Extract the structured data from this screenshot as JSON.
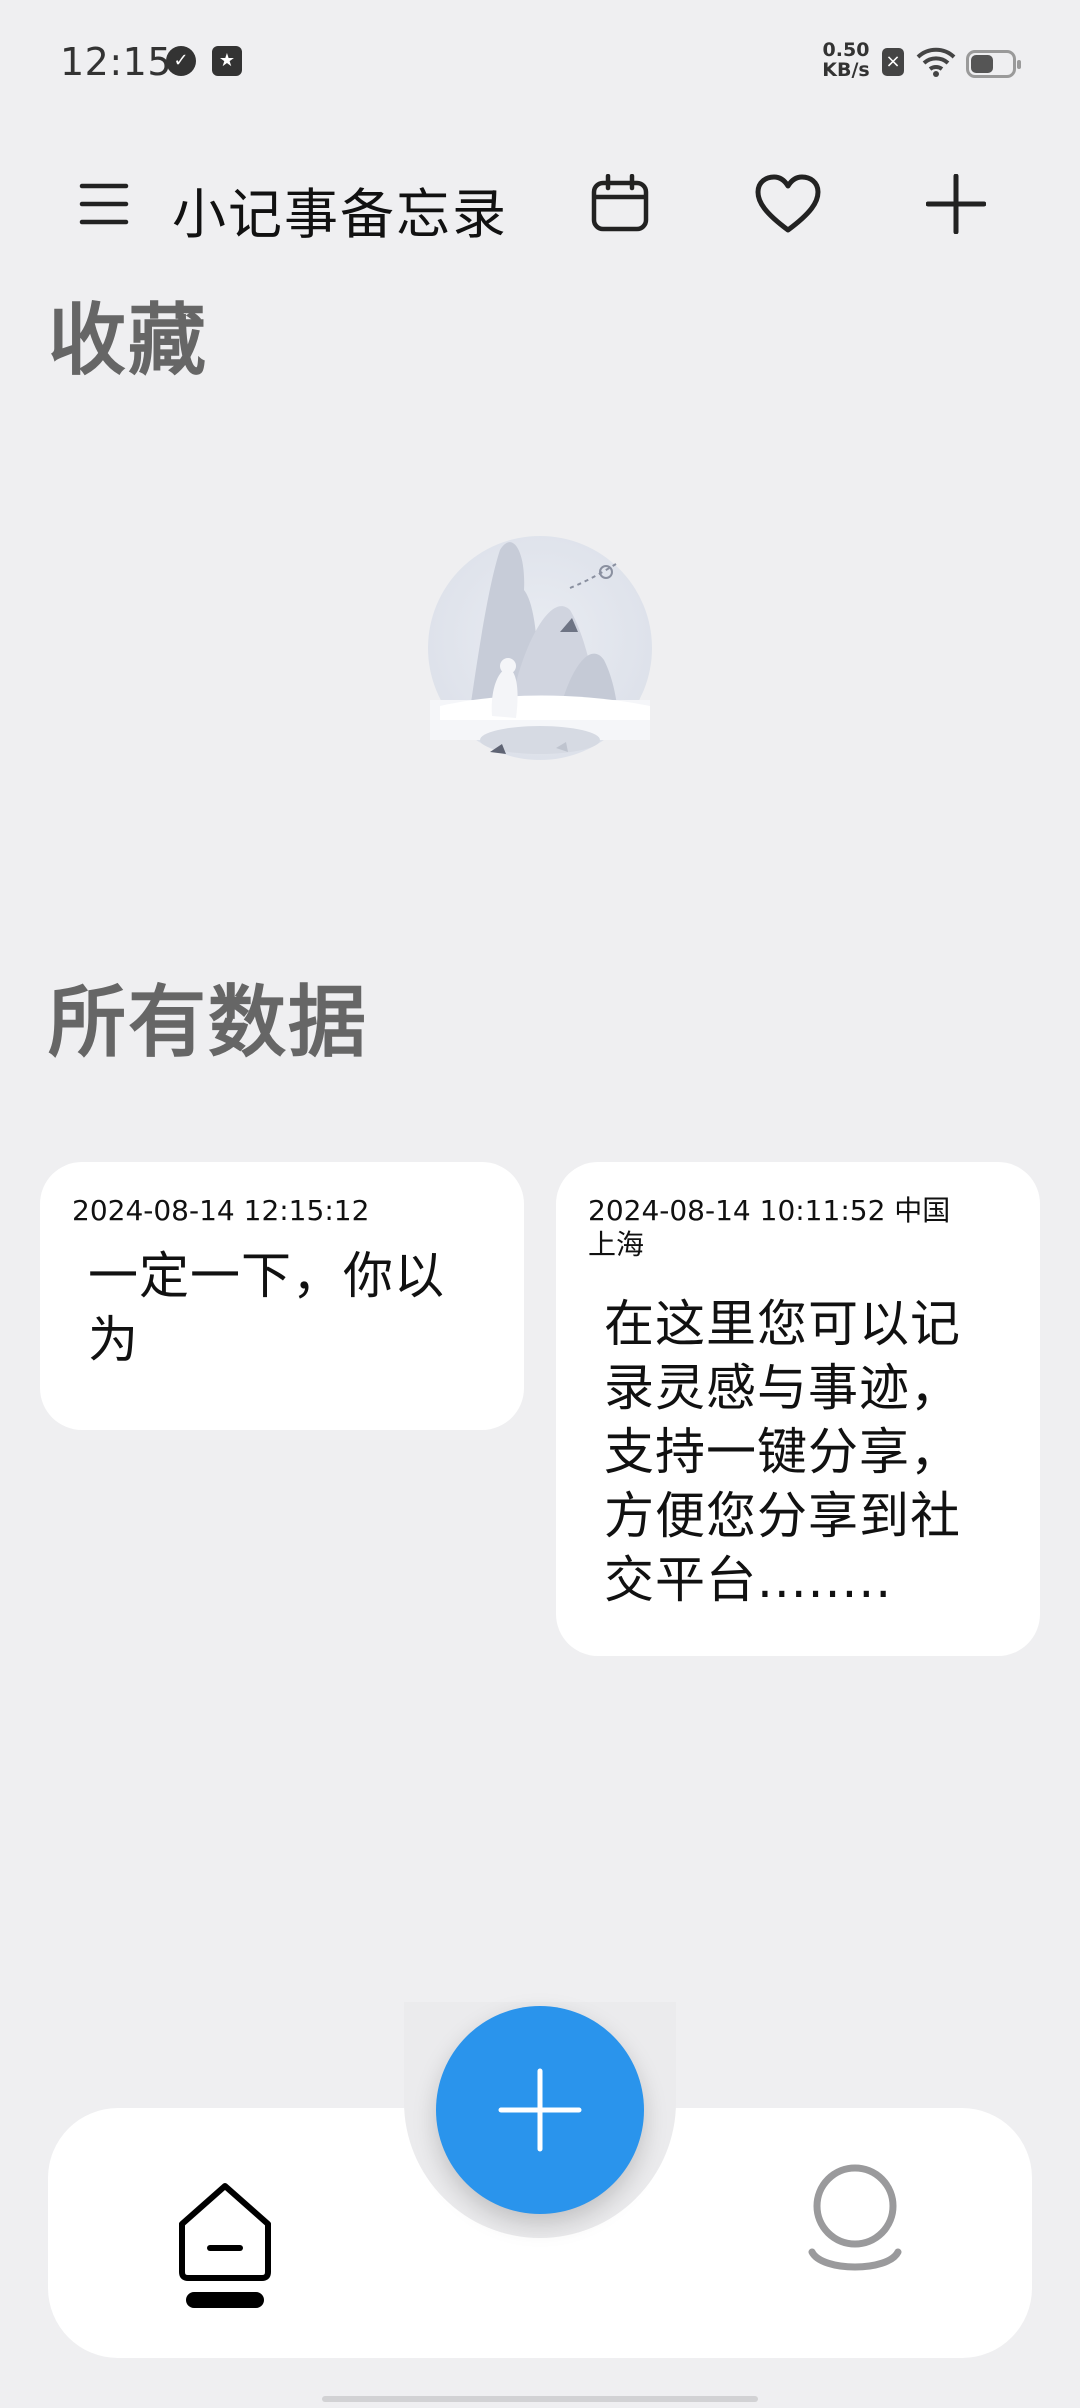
{
  "status_bar": {
    "time": "12:15",
    "net_speed_value": "0.50",
    "net_speed_unit": "KB/s",
    "icons": [
      "check-badge-icon",
      "star-badge-icon",
      "sim-card-icon",
      "wifi-icon",
      "battery-icon"
    ]
  },
  "header": {
    "title": "小记事备忘录",
    "icons": [
      "menu-icon",
      "calendar-icon",
      "heart-icon",
      "plus-icon"
    ]
  },
  "sections": {
    "favorites_title": "收藏",
    "all_data_title": "所有数据"
  },
  "notes": [
    {
      "meta": "2024-08-14 12:15:12",
      "content": "一定一下，你以为"
    },
    {
      "meta": "2024-08-14 10:11:52    中国 上海",
      "content": "在这里您可以记录灵感与事迹，支持一键分享，方便您分享到社交平台........"
    }
  ],
  "bottom_nav": {
    "items": [
      "home-icon",
      "add-icon",
      "profile-icon"
    ],
    "active": "home",
    "fab_color": "#2a94ec"
  }
}
